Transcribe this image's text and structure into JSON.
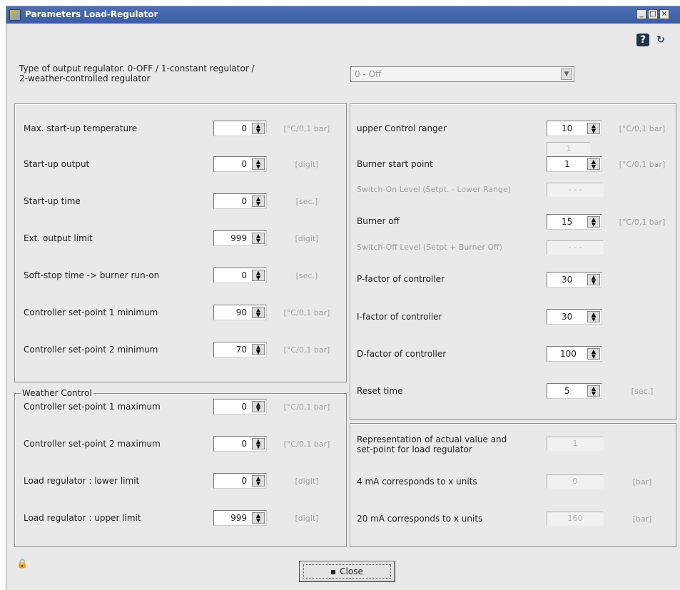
{
  "window": {
    "title": "Parameters Load-Regulator",
    "controls": [
      "_",
      "□",
      "×"
    ]
  },
  "toolbar": {
    "help": "?",
    "refresh": "↻"
  },
  "regulator_type": {
    "label_line1": "Type of output regulator. 0-OFF / 1-constant regulator /",
    "label_line2": "2-weather-controlled regulator",
    "value": "0 - Off"
  },
  "left_rows": [
    {
      "label": "Max. start-up temperature",
      "value": "0",
      "unit": "[°C/0,1 bar]"
    },
    {
      "label": "Start-up output",
      "value": "0",
      "unit": "[digit]"
    },
    {
      "label": "Start-up time",
      "value": "0",
      "unit": "[sec.]"
    },
    {
      "label": "Ext. output limit",
      "value": "999",
      "unit": "[digit]"
    },
    {
      "label": "Soft-stop time -> burner run-on",
      "value": "0",
      "unit": "[sec.]"
    },
    {
      "label": "Controller set-point 1 minimum",
      "value": "90",
      "unit": "[°C/0,1 bar]"
    },
    {
      "label": "Controller set-point 2 minimum",
      "value": "70",
      "unit": "[°C/0,1 bar]"
    }
  ],
  "weather_control": {
    "title": "Weather Control",
    "rows": [
      {
        "label": "Controller set-point 1 maximum",
        "value": "0",
        "unit": "[°C/0,1 bar]"
      },
      {
        "label": "Controller set-point 2 maximum",
        "value": "0",
        "unit": "[°C/0,1 bar]"
      },
      {
        "label": "Load regulator : lower limit",
        "value": "0",
        "unit": "[digit]"
      },
      {
        "label": "Load regulator : upper limit",
        "value": "999",
        "unit": "[digit]"
      }
    ]
  },
  "right_rows": {
    "upper_control": {
      "label": "upper Control ranger",
      "value": "10",
      "unit": "[°C/0,1 bar]"
    },
    "burner_start": {
      "label": "Burner start point",
      "value": "1",
      "upper_value": "1",
      "unit": "[°C/0,1 bar]"
    },
    "switch_on": {
      "label": "Switch-On Level (Setpt. - Lower Range)",
      "value": "- - -"
    },
    "burner_off": {
      "label": "Burner off",
      "value": "15",
      "unit": "[°C/0,1 bar]"
    },
    "switch_off": {
      "label": "Switch-Off Level (Setpt + Burner Off)",
      "value": "- - -"
    },
    "p_factor": {
      "label": "P-factor of controller",
      "value": "30"
    },
    "i_factor": {
      "label": "I-factor of controller",
      "value": "30"
    },
    "d_factor": {
      "label": "D-factor of controller",
      "value": "100"
    },
    "reset_time": {
      "label": "Reset time",
      "value": "5",
      "unit": "[sec.]"
    }
  },
  "representation": {
    "label_line1": "Representation of actual value and",
    "label_line2": "set-point for load regulator",
    "value": "1",
    "ma4": {
      "label": "4 mA corresponds to x units",
      "value": "0",
      "unit": "[bar]"
    },
    "ma20": {
      "label": "20 mA corresponds to x units",
      "value": "160",
      "unit": "[bar]"
    }
  },
  "footer": {
    "close_label": "Close"
  }
}
